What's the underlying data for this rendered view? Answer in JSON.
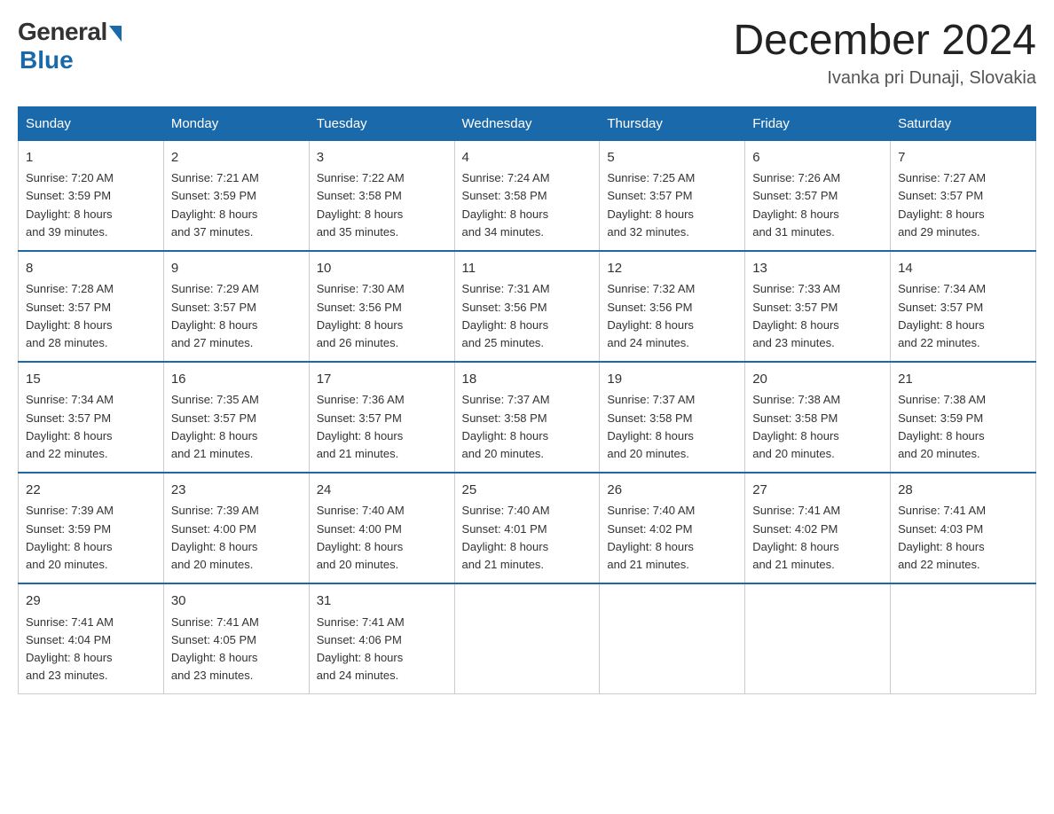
{
  "logo": {
    "general": "General",
    "blue": "Blue"
  },
  "title": "December 2024",
  "subtitle": "Ivanka pri Dunaji, Slovakia",
  "headers": [
    "Sunday",
    "Monday",
    "Tuesday",
    "Wednesday",
    "Thursday",
    "Friday",
    "Saturday"
  ],
  "weeks": [
    [
      {
        "day": "1",
        "info": "Sunrise: 7:20 AM\nSunset: 3:59 PM\nDaylight: 8 hours\nand 39 minutes."
      },
      {
        "day": "2",
        "info": "Sunrise: 7:21 AM\nSunset: 3:59 PM\nDaylight: 8 hours\nand 37 minutes."
      },
      {
        "day": "3",
        "info": "Sunrise: 7:22 AM\nSunset: 3:58 PM\nDaylight: 8 hours\nand 35 minutes."
      },
      {
        "day": "4",
        "info": "Sunrise: 7:24 AM\nSunset: 3:58 PM\nDaylight: 8 hours\nand 34 minutes."
      },
      {
        "day": "5",
        "info": "Sunrise: 7:25 AM\nSunset: 3:57 PM\nDaylight: 8 hours\nand 32 minutes."
      },
      {
        "day": "6",
        "info": "Sunrise: 7:26 AM\nSunset: 3:57 PM\nDaylight: 8 hours\nand 31 minutes."
      },
      {
        "day": "7",
        "info": "Sunrise: 7:27 AM\nSunset: 3:57 PM\nDaylight: 8 hours\nand 29 minutes."
      }
    ],
    [
      {
        "day": "8",
        "info": "Sunrise: 7:28 AM\nSunset: 3:57 PM\nDaylight: 8 hours\nand 28 minutes."
      },
      {
        "day": "9",
        "info": "Sunrise: 7:29 AM\nSunset: 3:57 PM\nDaylight: 8 hours\nand 27 minutes."
      },
      {
        "day": "10",
        "info": "Sunrise: 7:30 AM\nSunset: 3:56 PM\nDaylight: 8 hours\nand 26 minutes."
      },
      {
        "day": "11",
        "info": "Sunrise: 7:31 AM\nSunset: 3:56 PM\nDaylight: 8 hours\nand 25 minutes."
      },
      {
        "day": "12",
        "info": "Sunrise: 7:32 AM\nSunset: 3:56 PM\nDaylight: 8 hours\nand 24 minutes."
      },
      {
        "day": "13",
        "info": "Sunrise: 7:33 AM\nSunset: 3:57 PM\nDaylight: 8 hours\nand 23 minutes."
      },
      {
        "day": "14",
        "info": "Sunrise: 7:34 AM\nSunset: 3:57 PM\nDaylight: 8 hours\nand 22 minutes."
      }
    ],
    [
      {
        "day": "15",
        "info": "Sunrise: 7:34 AM\nSunset: 3:57 PM\nDaylight: 8 hours\nand 22 minutes."
      },
      {
        "day": "16",
        "info": "Sunrise: 7:35 AM\nSunset: 3:57 PM\nDaylight: 8 hours\nand 21 minutes."
      },
      {
        "day": "17",
        "info": "Sunrise: 7:36 AM\nSunset: 3:57 PM\nDaylight: 8 hours\nand 21 minutes."
      },
      {
        "day": "18",
        "info": "Sunrise: 7:37 AM\nSunset: 3:58 PM\nDaylight: 8 hours\nand 20 minutes."
      },
      {
        "day": "19",
        "info": "Sunrise: 7:37 AM\nSunset: 3:58 PM\nDaylight: 8 hours\nand 20 minutes."
      },
      {
        "day": "20",
        "info": "Sunrise: 7:38 AM\nSunset: 3:58 PM\nDaylight: 8 hours\nand 20 minutes."
      },
      {
        "day": "21",
        "info": "Sunrise: 7:38 AM\nSunset: 3:59 PM\nDaylight: 8 hours\nand 20 minutes."
      }
    ],
    [
      {
        "day": "22",
        "info": "Sunrise: 7:39 AM\nSunset: 3:59 PM\nDaylight: 8 hours\nand 20 minutes."
      },
      {
        "day": "23",
        "info": "Sunrise: 7:39 AM\nSunset: 4:00 PM\nDaylight: 8 hours\nand 20 minutes."
      },
      {
        "day": "24",
        "info": "Sunrise: 7:40 AM\nSunset: 4:00 PM\nDaylight: 8 hours\nand 20 minutes."
      },
      {
        "day": "25",
        "info": "Sunrise: 7:40 AM\nSunset: 4:01 PM\nDaylight: 8 hours\nand 21 minutes."
      },
      {
        "day": "26",
        "info": "Sunrise: 7:40 AM\nSunset: 4:02 PM\nDaylight: 8 hours\nand 21 minutes."
      },
      {
        "day": "27",
        "info": "Sunrise: 7:41 AM\nSunset: 4:02 PM\nDaylight: 8 hours\nand 21 minutes."
      },
      {
        "day": "28",
        "info": "Sunrise: 7:41 AM\nSunset: 4:03 PM\nDaylight: 8 hours\nand 22 minutes."
      }
    ],
    [
      {
        "day": "29",
        "info": "Sunrise: 7:41 AM\nSunset: 4:04 PM\nDaylight: 8 hours\nand 23 minutes."
      },
      {
        "day": "30",
        "info": "Sunrise: 7:41 AM\nSunset: 4:05 PM\nDaylight: 8 hours\nand 23 minutes."
      },
      {
        "day": "31",
        "info": "Sunrise: 7:41 AM\nSunset: 4:06 PM\nDaylight: 8 hours\nand 24 minutes."
      },
      {
        "day": "",
        "info": ""
      },
      {
        "day": "",
        "info": ""
      },
      {
        "day": "",
        "info": ""
      },
      {
        "day": "",
        "info": ""
      }
    ]
  ]
}
